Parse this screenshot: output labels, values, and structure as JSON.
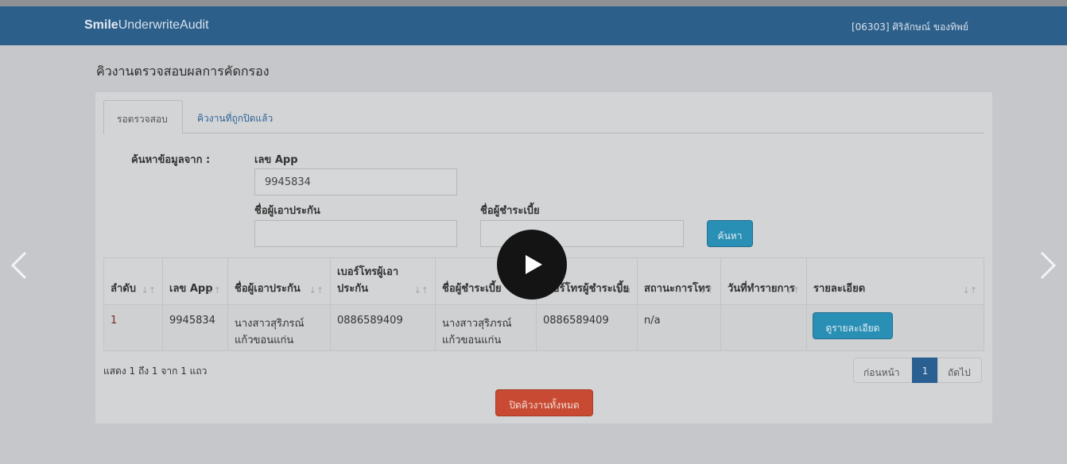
{
  "app": {
    "brand_bold": "Smile",
    "brand_rest": "UnderwriteAudit",
    "user": "[06303] ศิริลักษณ์ ของทิพย์"
  },
  "page": {
    "title": "คิวงานตรวจสอบผลการคัดกรอง"
  },
  "tabs": [
    {
      "label": "รอตรวจสอบ"
    },
    {
      "label": "คิวงานที่ถูกปิดแล้ว"
    }
  ],
  "search": {
    "from_label": "ค้นหาข้อมูลจาก :",
    "app_label": "เลข App",
    "app_value": "9945834",
    "insured_label": "ชื่อผู้เอาประกัน",
    "insured_value": "",
    "payer_label": "ชื่อผู้ชำระเบี้ย",
    "payer_value": "",
    "button": "ค้นหา"
  },
  "table": {
    "headers": [
      "ลำดับ",
      "เลข App",
      "ชื่อผู้เอาประกัน",
      "เบอร์โทรผู้เอาประกัน",
      "ชื่อผู้ชำระเบี้ย",
      "เบอร์โทรผู้ชำระเบี้ย",
      "สถานะการโทร",
      "วันที่ทำรายการ",
      "รายละเอียด"
    ],
    "rows": [
      {
        "no": "1",
        "app": "9945834",
        "insured": "นางสาวสุริภรณ์ แก้วขอนแก่น",
        "insured_phone": "0886589409",
        "payer": "นางสาวสุริภรณ์ แก้วขอนแก่น",
        "payer_phone": "0886589409",
        "call_status": "n/a",
        "date": "",
        "detail_button": "ดูรายละเอียด"
      }
    ]
  },
  "footer": {
    "info": "แสดง 1 ถึง 1 จาก 1 แถว",
    "pagination": {
      "prev": "ก่อนหน้า",
      "current": "1",
      "next": "ถัดไป"
    },
    "close_all": "ปิดคิวงานทั้งหมด"
  },
  "colors": {
    "navbar": "#2d5f8b",
    "primary_button": "#2a8fb5",
    "danger_button": "#c94a32",
    "active_page": "#2a5f92"
  }
}
